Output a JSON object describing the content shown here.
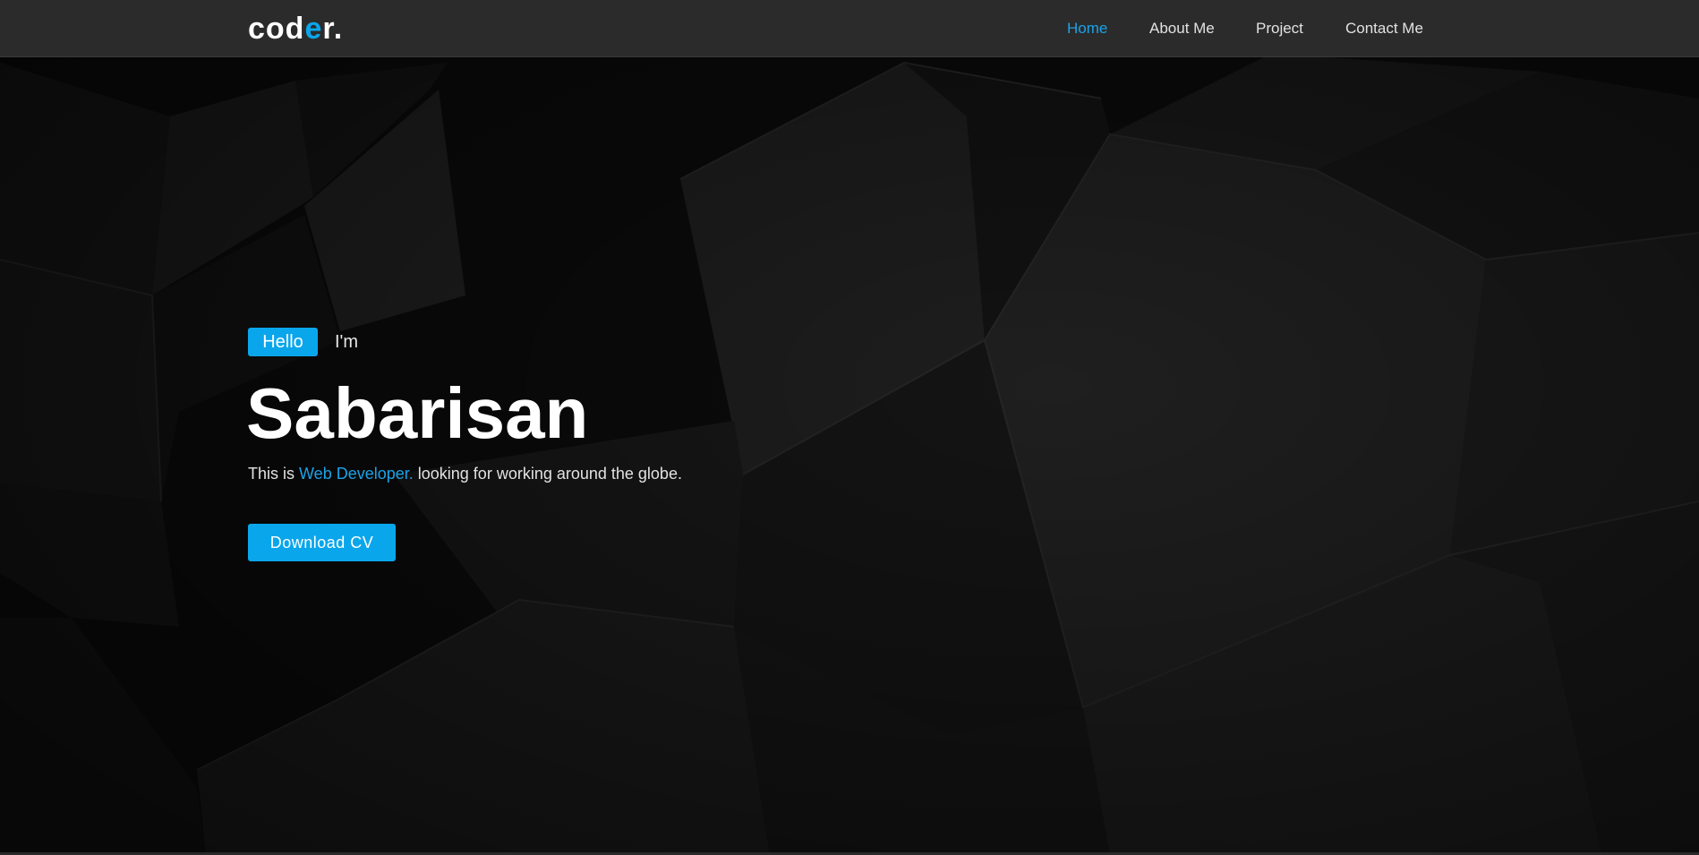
{
  "header": {
    "logo_main": "cod",
    "logo_accent": "e",
    "logo_end": "r."
  },
  "nav": {
    "items": [
      {
        "label": "Home",
        "active": true
      },
      {
        "label": "About Me",
        "active": false
      },
      {
        "label": "Project",
        "active": false
      },
      {
        "label": "Contact Me",
        "active": false
      }
    ]
  },
  "hero": {
    "badge": "Hello",
    "intro": "I'm",
    "name": "Sabarisan",
    "tagline_prefix": "This is ",
    "tagline_role": "Web Developer.",
    "tagline_suffix": " looking for working around the globe.",
    "cta_label": "Download CV"
  },
  "colors": {
    "accent": "#0aa6ec",
    "navbar_bg": "#2b2b2b",
    "hero_bg": "#0b0b0b",
    "text": "#ffffff"
  }
}
